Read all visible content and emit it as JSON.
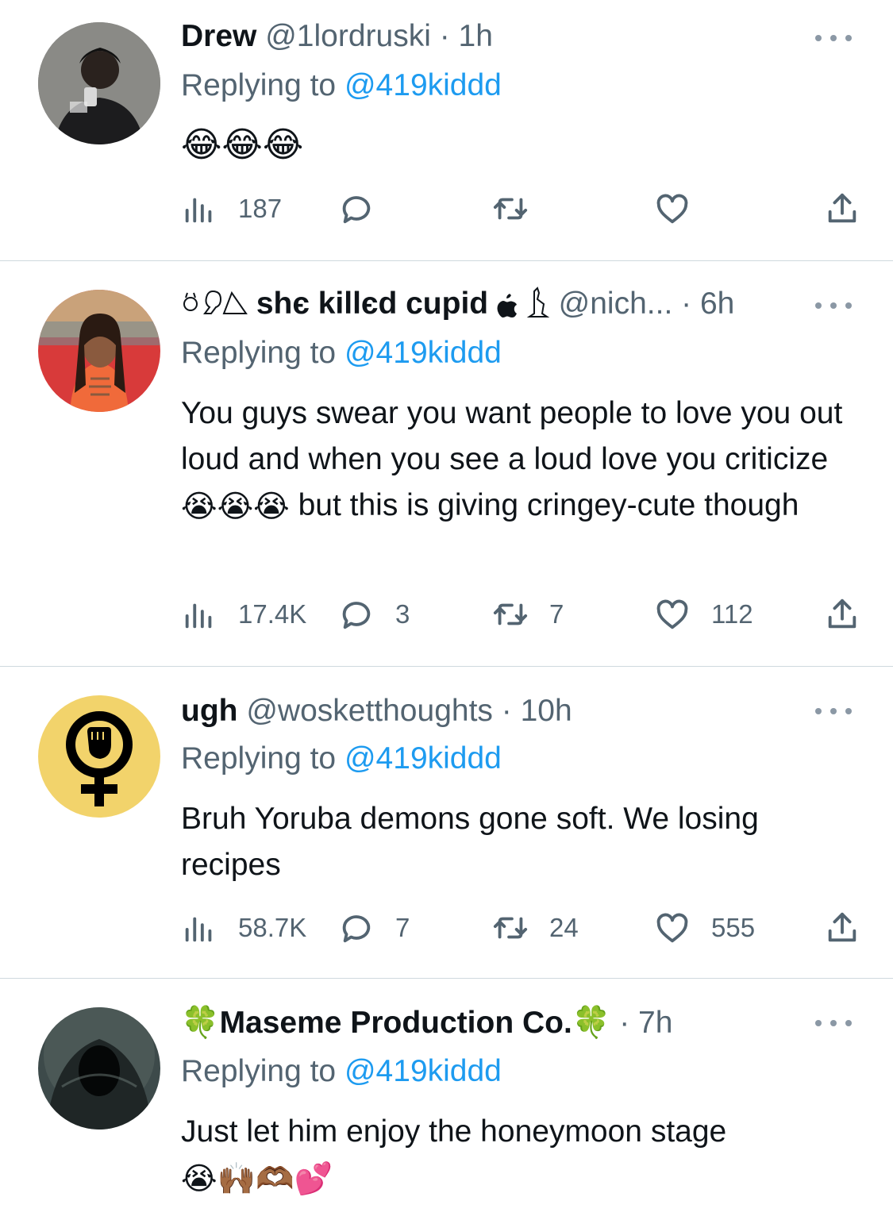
{
  "tweets": [
    {
      "name": "Drew",
      "handle": "@1lordruski",
      "time": "· 1h",
      "replying_prefix": "Replying to",
      "replying_to": "@419kiddd",
      "text": "",
      "emoji": [
        "😂",
        "😂",
        "😂"
      ],
      "views": "187",
      "replies": "",
      "retweets": "",
      "likes": ""
    },
    {
      "name": "shє killєd cupid",
      "handle": "@nich...",
      "time": "· 6h",
      "replying_prefix": "Replying to",
      "replying_to": "@419kiddd",
      "text_a": "You guys swear you want people to love you out loud and when you see a loud love you criticize",
      "emoji": [
        "😭",
        "😭",
        "😭"
      ],
      "text_b": "but this is giving cringey-cute though",
      "views": "17.4K",
      "replies": "3",
      "retweets": "7",
      "likes": "112"
    },
    {
      "name": "ugh",
      "handle": "@wosketthoughts",
      "time": "· 10h",
      "replying_prefix": "Replying to",
      "replying_to": "@419kiddd",
      "text": "Bruh Yoruba demons gone soft. We losing recipes",
      "views": "58.7K",
      "replies": "7",
      "retweets": "24",
      "likes": "555"
    },
    {
      "name_prefix": "🍀",
      "name": "Maseme Production Co.",
      "name_suffix": "🍀",
      "time": "· 7h",
      "replying_prefix": "Replying to",
      "replying_to": "@419kiddd",
      "text": "Just let him enjoy the honeymoon stage",
      "emoji": [
        "😭",
        "🙌🏾",
        "🫶🏾",
        "💕"
      ]
    }
  ],
  "icons": {
    "views": "views-icon",
    "reply": "reply-icon",
    "retweet": "retweet-icon",
    "like": "like-icon",
    "share": "share-icon",
    "more": "more-icon"
  },
  "colors": {
    "link": "#1d9bf0",
    "secondary": "#536471",
    "divider": "#cfd9de"
  }
}
